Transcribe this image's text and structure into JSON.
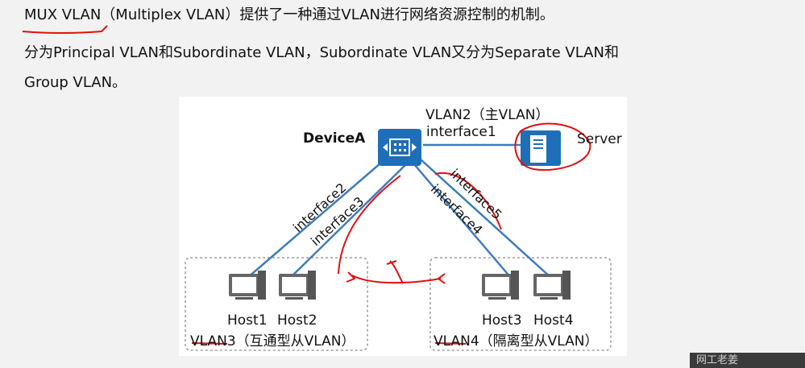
{
  "paragraphs": {
    "line1": "MUX VLAN（Multiplex VLAN）提供了一种通过VLAN进行网络资源控制的机制。",
    "line2": "分为Principal VLAN和Subordinate VLAN，Subordinate VLAN又分为Separate VLAN和",
    "line3": "Group VLAN。"
  },
  "diagram": {
    "device_label": "DeviceA",
    "vlan2_label": "VLAN2（主VLAN）",
    "interface1": "interface1",
    "interface2": "interface2",
    "interface3": "interface3",
    "interface4": "interface4",
    "interface5": "interface5",
    "server_label": "Server",
    "host1": "Host1",
    "host2": "Host2",
    "host3": "Host3",
    "host4": "Host4",
    "vlan3_label": "VLAN3（互通型从VLAN）",
    "vlan4_label": "VLAN4（隔离型从VLAN）"
  },
  "colors": {
    "link": "#3e7bbd",
    "switch": "#1f6fb8",
    "annotation": "#e01010",
    "group_border": "#8a8a8a"
  },
  "icons": {
    "switch": "switch-icon",
    "server": "server-icon",
    "host": "desktop-computer-icon"
  },
  "watermark": "网工老姜"
}
